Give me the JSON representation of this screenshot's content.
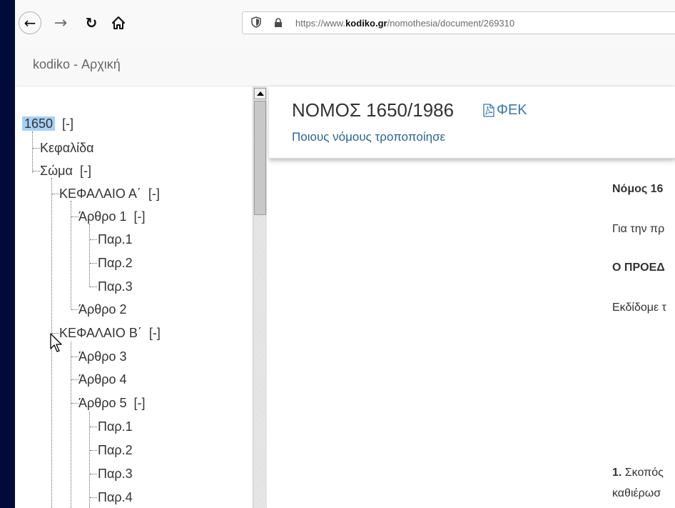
{
  "browser": {
    "url_prefix": "https://www.",
    "url_domain": "kodiko.gr",
    "url_path": "/nomothesia/document/269310"
  },
  "site": {
    "brand": "kodiko - Αρχική"
  },
  "tree": {
    "root_label": "1650",
    "toggle": "[-]",
    "items": {
      "kefalida": "Κεφαλίδα",
      "soma": "Σώμα",
      "kef_a": "ΚΕΦΑΛΑΙΟ Α΄",
      "arthro1": "Άρθρο 1",
      "a1_par1": "Παρ.1",
      "a1_par2": "Παρ.2",
      "a1_par3": "Παρ.3",
      "arthro2": "Άρθρο 2",
      "kef_b": "ΚΕΦΑΛΑΙΟ Β΄",
      "arthro3": "Άρθρο 3",
      "arthro4": "Άρθρο 4",
      "arthro5": "Άρθρο 5",
      "a5_par1": "Παρ.1",
      "a5_par2": "Παρ.2",
      "a5_par3": "Παρ.3",
      "a5_par4": "Παρ.4"
    }
  },
  "document": {
    "title": "ΝΟΜΟΣ 1650/1986",
    "pdf_label": "ΦΕΚ",
    "amends_link": "Ποιους νόμους τροποποίησε",
    "lines": {
      "l1": "Νόμος 16",
      "l2": "Για την πρ",
      "l3": "Ο ΠΡΟΕΔ",
      "l4": "Εκδίδομε τ",
      "l5_num": "1.",
      "l5": " Σκοπός",
      "l6": "καθιέρωσ"
    }
  }
}
